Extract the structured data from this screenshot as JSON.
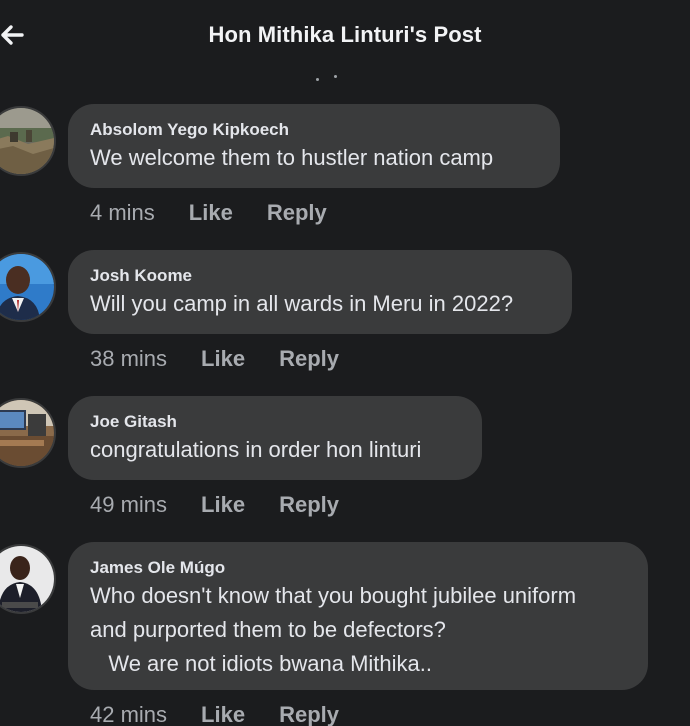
{
  "header": {
    "title": "Hon Mithika Linturi's Post",
    "back_icon": "arrow-left-icon"
  },
  "colors": {
    "background": "#1b1c1e",
    "bubble": "#3a3b3c",
    "text": "#e4e6eb",
    "meta": "#a8abb0"
  },
  "comments": [
    {
      "author": "Absolom Yego Kipkoech",
      "text": "We welcome them to hustler nation camp",
      "time": "4 mins",
      "like_label": "Like",
      "reply_label": "Reply"
    },
    {
      "author": "Josh Koome",
      "text": "Will you camp in all wards in Meru in 2022?",
      "time": "38 mins",
      "like_label": "Like",
      "reply_label": "Reply"
    },
    {
      "author": "Joe Gitash",
      "text": "congratulations in order hon linturi",
      "time": "49 mins",
      "like_label": "Like",
      "reply_label": "Reply"
    },
    {
      "author": "James Ole Múgo",
      "text": "Who doesn't know that you bought jubilee uniform\nand purported them to be defectors?\n   We are not idiots bwana Mithika..",
      "time": "42 mins",
      "like_label": "Like",
      "reply_label": "Reply"
    }
  ]
}
